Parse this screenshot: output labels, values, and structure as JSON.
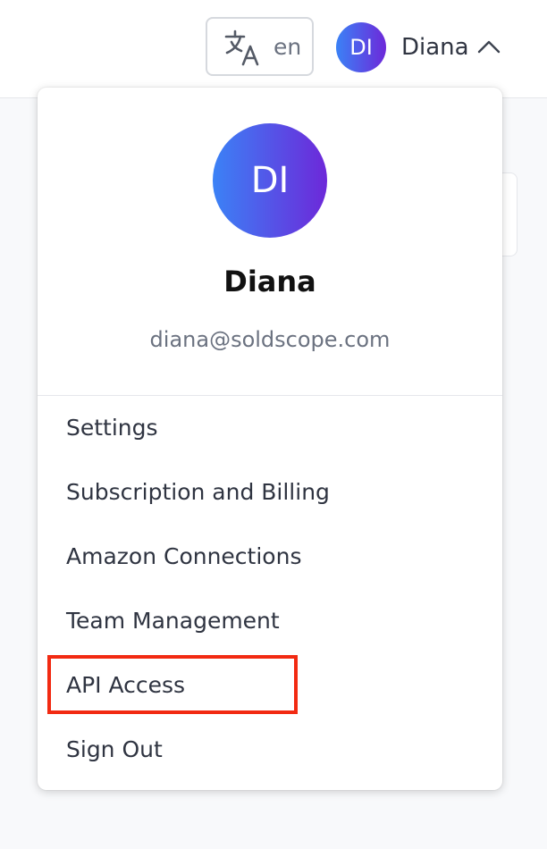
{
  "header": {
    "language": {
      "icon": "translate-icon",
      "code": "en"
    },
    "user": {
      "initials": "DI",
      "name": "Diana",
      "chevron_icon": "chevron-up-icon"
    }
  },
  "dropdown": {
    "avatar_initials": "DI",
    "name": "Diana",
    "email": "diana@soldscope.com",
    "items": [
      {
        "label": "Settings"
      },
      {
        "label": "Subscription and Billing"
      },
      {
        "label": "Amazon Connections"
      },
      {
        "label": "Team Management"
      },
      {
        "label": "API Access",
        "highlighted": true
      },
      {
        "label": "Sign Out"
      }
    ]
  },
  "colors": {
    "avatar_gradient_start": "#3b82f6",
    "avatar_gradient_end": "#6d28d9",
    "highlight_border": "#f22a12"
  }
}
